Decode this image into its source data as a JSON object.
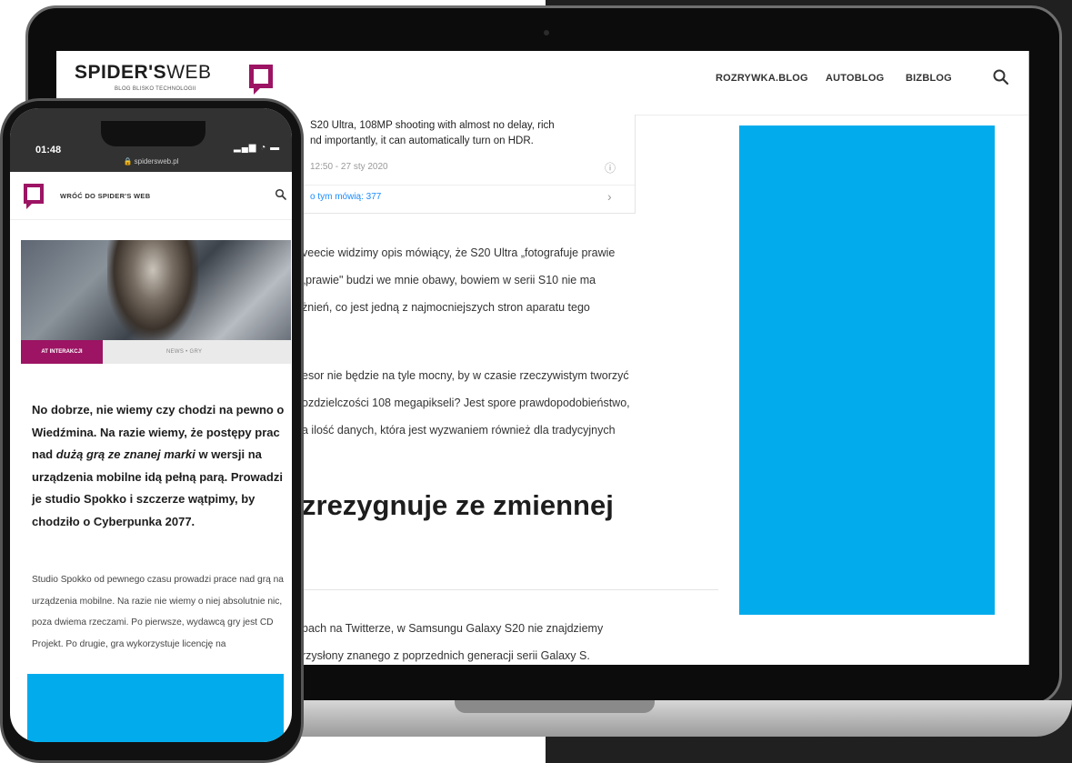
{
  "laptop": {
    "logo": {
      "word_bold": "SPIDER'S",
      "word_light": "WEB",
      "tagline": "BLOG BLISKO TECHNOLOGII"
    },
    "nav": [
      {
        "label": "ROZRYWKA.BLOG"
      },
      {
        "label": "AUTOBLOG"
      },
      {
        "label": "BIZBLOG"
      }
    ],
    "embed": {
      "text": "S20 Ultra, 108MP shooting with almost no delay, rich ... nd importantly, it can automatically turn on HDR.",
      "line1": "S20 Ultra, 108MP shooting with almost no delay, rich",
      "line2": "nd importantly, it can automatically turn on HDR.",
      "time": "12:50 - 27 sty 2020",
      "info_icon": "ⓘ",
      "link": "o tym mówią: 377",
      "chevron": "›"
    },
    "paragraphs": [
      {
        "lines": [
          "veecie widzimy opis mówiący, że S20 Ultra „fotografuje prawie",
          "„prawie\" budzi we mnie obawy, bowiem w serii S10 nie ma",
          "żnień, co jest jedną z najmocniejszych stron aparatu tego"
        ]
      },
      {
        "lines": [
          "esor nie będzie na tyle mocny, by w czasie rzeczywistym tworzyć",
          "ozdzielczości 108 megapikseli? Jest spore prawdopodobieństwo,",
          "a ilość danych, która jest wyzwaniem również dla tradycyjnych"
        ]
      },
      {
        "lines": [
          "bach na Twitterze, w Samsungu Galaxy S20 nie znajdziemy",
          "rzysłony znanego z poprzednich generacji serii Galaxy S."
        ]
      }
    ],
    "heading": "zrezygnuje ze zmiennej",
    "ad_color": "#02acec"
  },
  "phone": {
    "status_time": "01:48",
    "status_icons": "▂▄▆ ◔ ▬",
    "url": "🔒 spidersweb.pl",
    "back_link": "WRÓĆ DO SPIDER'S WEB",
    "hero_tag": "AT INTERAKCJI",
    "hero_cats": "NEWS   •   GRY",
    "lead_parts": {
      "p1": "No dobrze, nie wiemy czy chodzi na pewno o Wiedźmina. Na razie wiemy, że postępy prac nad ",
      "italic": "dużą grą ze znanej marki",
      "p2": " w wersji na urządzenia mobilne idą pełną parą. Prowadzi je studio Spokko i szczerze wątpimy, by chodziło o Cyberpunka 2077."
    },
    "body": "Studio Spokko od pewnego czasu prowadzi prace nad grą na urządzenia mobilne. Na razie nie wiemy o niej absolutnie nic, poza dwiema rzeczami. Po pierwsze, wydawcą gry jest CD Projekt. Po drugie, gra wykorzystuje licencję na",
    "ad_color": "#02acec"
  },
  "colors": {
    "brand": "#9c1463",
    "ad": "#02acec"
  }
}
